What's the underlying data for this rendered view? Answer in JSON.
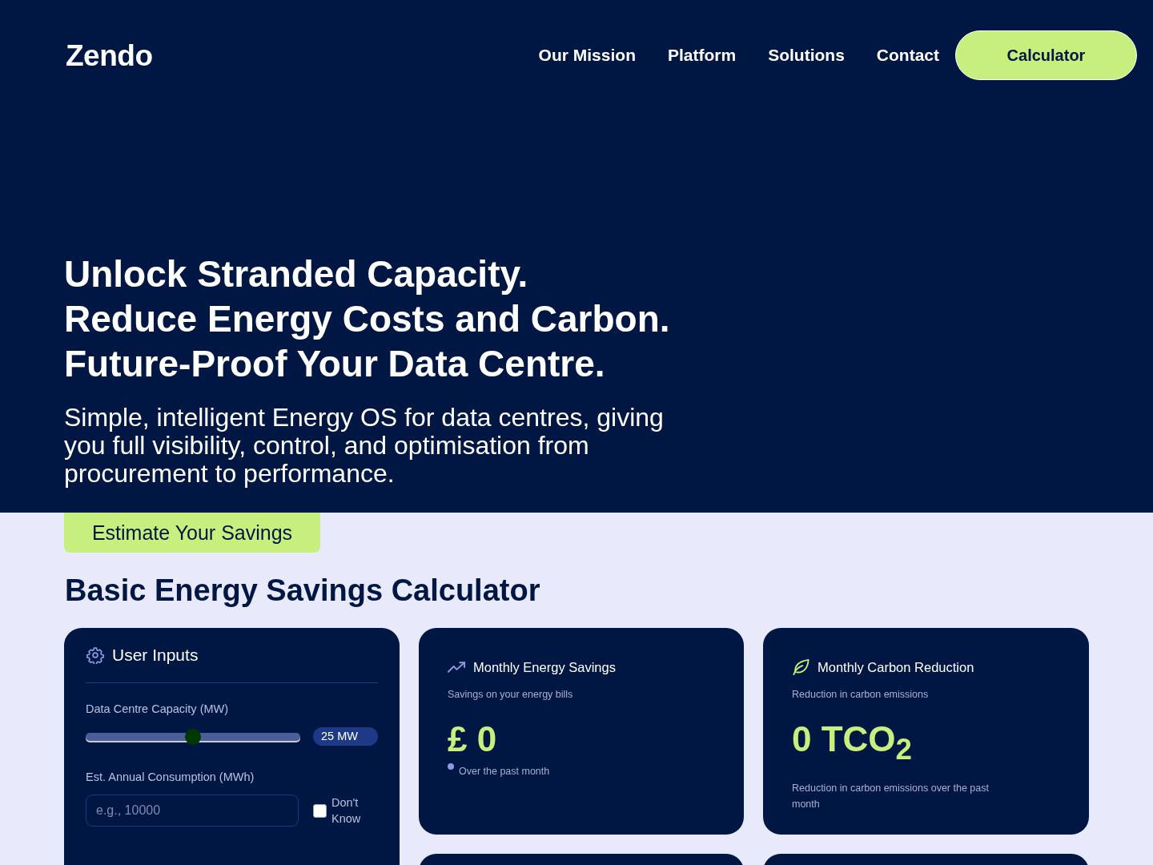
{
  "nav": {
    "logo": "Zendo",
    "links": [
      "Our Mission",
      "Platform",
      "Solutions",
      "Contact"
    ],
    "cta": "Calculator"
  },
  "hero": {
    "headline": [
      "Unlock Stranded Capacity.",
      "Reduce Energy Costs and Carbon.",
      "Future-Proof Your Data Centre."
    ],
    "subtitle": "Simple, intelligent Energy OS for data centres, giving you full visibility, control, and optimisation from procurement to performance.",
    "cta": "Estimate Your Savings"
  },
  "calculator": {
    "title": "Basic Energy Savings Calculator",
    "inputs": {
      "title": "User Inputs",
      "fields": [
        {
          "kind": "slider",
          "label": "Data Centre Capacity (MW)",
          "level": 0.5,
          "reading": "25 MW"
        },
        {
          "kind": "number",
          "label": "Est. Annual Consumption (MWh)",
          "placeholder": "e.g., 10000",
          "checkbox": {
            "label": "Don't Know",
            "checked": false
          }
        }
      ]
    },
    "results": [
      {
        "kind": "savings",
        "title": "Monthly Energy Savings",
        "caption": "Savings on your energy bills",
        "value": "£ 0",
        "note": "Over the past month"
      },
      {
        "kind": "carbon",
        "title": "Monthly Carbon Reduction",
        "caption": "Reduction in carbon emissions",
        "value": "0 TCO$_{2}$",
        "note": "Reduction in carbon emissions over the past month"
      }
    ]
  }
}
